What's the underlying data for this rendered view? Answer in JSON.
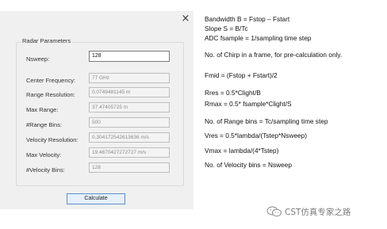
{
  "dialog": {
    "close_glyph": "×",
    "group_title": "Radar Parameters",
    "fields": [
      {
        "label": "Nsweep:",
        "value": "128",
        "editable": true
      },
      {
        "label": "Center Frequency:",
        "value": "77 GHz",
        "editable": false
      },
      {
        "label": "Range Resolution:",
        "value": "0.0749481145 m",
        "editable": false
      },
      {
        "label": "Max Range:",
        "value": "37.47405725 m",
        "editable": false
      },
      {
        "label": "#Range Bins:",
        "value": "500",
        "editable": false
      },
      {
        "label": "Velocity Resolution:",
        "value": "0.304172542613636 m/s",
        "editable": false
      },
      {
        "label": "Max Velocity:",
        "value": "19.4670427272727 m/s",
        "editable": false
      },
      {
        "label": "#Velocity Bins:",
        "value": "128",
        "editable": false
      }
    ],
    "calculate_label": "Calculate"
  },
  "notes": [
    "Bandwidth B = Fstop – Fstart",
    "Slope S = B/Tc",
    "ADC fsample = 1/sampling time step",
    "No. of Chirp in a frame, for pre-calculation only.",
    "Fmid = (Fstop + Fstart)/2",
    "Rres = 0.5*Clight/B",
    "Rmax = 0.5* fsample*Clight/S",
    "No. of Range bins = Tc/sampling time step",
    "Vres = 0.5*lambda/(Tstep*Nsweep)",
    "Vmax = lambda/(4*Tstep)",
    "No. of Velocity bins = Nsweep"
  ],
  "watermark": {
    "text": "CST仿真专家之路",
    "icon": "wechat-icon"
  }
}
